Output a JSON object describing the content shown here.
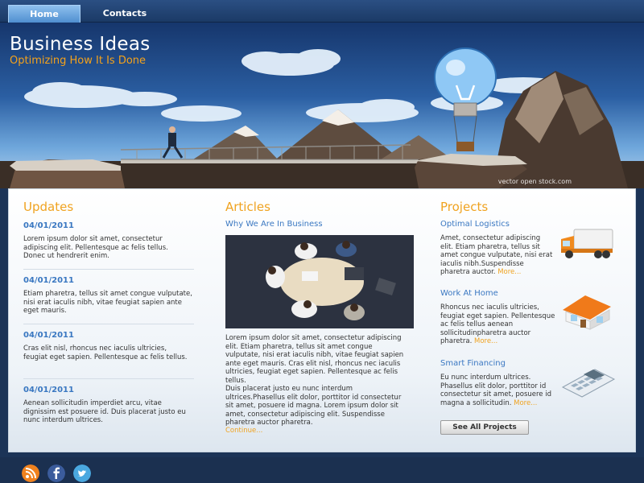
{
  "nav": {
    "home": "Home",
    "contacts": "Contacts"
  },
  "header": {
    "title": "Business Ideas",
    "subtitle": "Optimizing How It Is Done",
    "watermark": "vector open stock.com"
  },
  "updates": {
    "title": "Updates",
    "items": [
      {
        "date": "04/01/2011",
        "text": "Lorem ipsum dolor sit amet, consectetur adipiscing elit. Pellentesque ac felis tellus. Donec ut hendrerit enim."
      },
      {
        "date": "04/01/2011",
        "text": "Etiam pharetra, tellus sit amet congue vulputate, nisi erat iaculis nibh, vitae feugiat sapien ante eget mauris."
      },
      {
        "date": "04/01/2011",
        "text": "Cras elit nisl, rhoncus nec iaculis ultricies, feugiat eget sapien. Pellentesque ac felis tellus."
      },
      {
        "date": "04/01/2011",
        "text": "Aenean sollicitudin imperdiet arcu, vitae dignissim est posuere id. Duis placerat justo eu nunc interdum ultrices."
      }
    ]
  },
  "articles": {
    "title": "Articles",
    "heading": "Why We Are In Business",
    "para1": "Lorem ipsum dolor sit amet, consectetur adipiscing elit. Etiam pharetra, tellus sit amet congue vulputate, nisi erat iaculis nibh, vitae feugiat sapien ante eget mauris. Cras elit nisl, rhoncus nec iaculis ultricies, feugiat eget sapien. Pellentesque ac felis tellus.",
    "para2": "Duis placerat justo eu nunc interdum ultrices.Phasellus elit dolor, porttitor id consectetur sit amet, posuere id magna. Lorem ipsum dolor sit amet, consectetur adipiscing elit. Suspendisse pharetra auctor pharetra.",
    "continue": "Continue..."
  },
  "projects": {
    "title": "Projects",
    "items": [
      {
        "title": "Optimal Logistics",
        "text": "Amet, consectetur adipiscing elit. Etiam pharetra, tellus sit amet congue vulputate, nisi erat iaculis nibh.Suspendisse pharetra auctor.",
        "more": "More...",
        "icon": "truck-icon"
      },
      {
        "title": "Work At Home",
        "text": "Rhoncus nec iaculis ultricies, feugiat eget sapien. Pellentesque ac felis tellus aenean sollicitudinpharetra auctor pharetra.",
        "more": "More...",
        "icon": "house-icon"
      },
      {
        "title": "Smart Financing",
        "text": "Eu nunc interdum ultrices. Phasellus elit dolor, porttitor id consectetur sit amet, posuere id magna a sollicitudin.",
        "more": "More...",
        "icon": "calculator-icon"
      }
    ],
    "see_all": "See All Projects"
  },
  "footer": {
    "icons": [
      "rss-icon",
      "facebook-icon",
      "twitter-icon"
    ]
  },
  "colors": {
    "accent_orange": "#f0a320",
    "link_blue": "#3b78c2",
    "nav_bg": "#1b3a66",
    "footer_bg": "#1b3050"
  }
}
